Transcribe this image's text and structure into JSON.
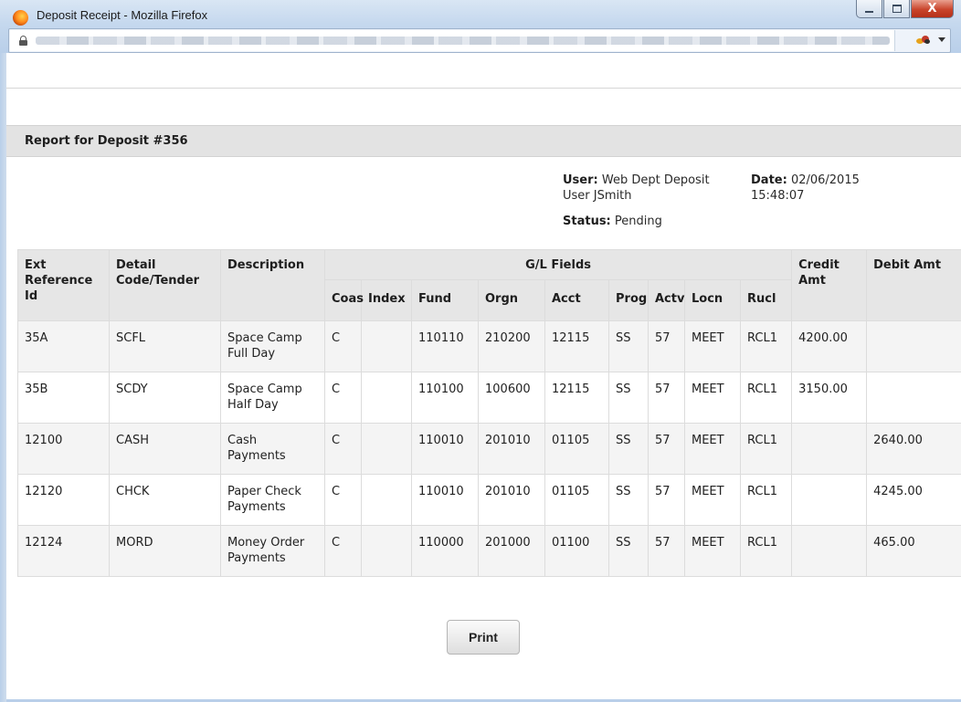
{
  "window": {
    "title": "Deposit Receipt - Mozilla Firefox",
    "minimize_label": "▭",
    "maximize_label": "□",
    "close_label": "X"
  },
  "address_bar": {
    "url": ""
  },
  "report": {
    "heading": "Report for Deposit #356",
    "user_label": "User:",
    "user_value_line1": "Web Dept Deposit",
    "user_value_line2": "User JSmith",
    "date_label": "Date:",
    "date_value_line1": "02/06/2015",
    "date_value_line2": "15:48:07",
    "status_label": "Status:",
    "status_value": "Pending"
  },
  "table": {
    "headers": {
      "ext_reference_id": "Ext Reference Id",
      "detail_code": "Detail Code/Tender",
      "description": "Description",
      "gl_fields": "G/L Fields",
      "credit_amt": "Credit Amt",
      "debit_amt": "Debit Amt",
      "coas": "Coas",
      "index": "Index",
      "fund": "Fund",
      "orgn": "Orgn",
      "acct": "Acct",
      "prog": "Prog",
      "actv": "Actv",
      "locn": "Locn",
      "rucl": "Rucl"
    },
    "rows": [
      {
        "ext": "35A",
        "code": "SCFL",
        "desc": "Space Camp Full Day",
        "coas": "C",
        "index": "",
        "fund": "110110",
        "orgn": "210200",
        "acct": "12115",
        "prog": "SS",
        "actv": "57",
        "locn": "MEET",
        "rucl": "RCL1",
        "credit": "4200.00",
        "debit": ""
      },
      {
        "ext": "35B",
        "code": "SCDY",
        "desc": "Space Camp Half Day",
        "coas": "C",
        "index": "",
        "fund": "110100",
        "orgn": "100600",
        "acct": "12115",
        "prog": "SS",
        "actv": "57",
        "locn": "MEET",
        "rucl": "RCL1",
        "credit": "3150.00",
        "debit": ""
      },
      {
        "ext": "12100",
        "code": "CASH",
        "desc": "Cash Payments",
        "coas": "C",
        "index": "",
        "fund": "110010",
        "orgn": "201010",
        "acct": "01105",
        "prog": "SS",
        "actv": "57",
        "locn": "MEET",
        "rucl": "RCL1",
        "credit": "",
        "debit": "2640.00"
      },
      {
        "ext": "12120",
        "code": "CHCK",
        "desc": "Paper Check Payments",
        "coas": "C",
        "index": "",
        "fund": "110010",
        "orgn": "201010",
        "acct": "01105",
        "prog": "SS",
        "actv": "57",
        "locn": "MEET",
        "rucl": "RCL1",
        "credit": "",
        "debit": "4245.00"
      },
      {
        "ext": "12124",
        "code": "MORD",
        "desc": "Money Order Payments",
        "coas": "C",
        "index": "",
        "fund": "110000",
        "orgn": "201000",
        "acct": "01100",
        "prog": "SS",
        "actv": "57",
        "locn": "MEET",
        "rucl": "RCL1",
        "credit": "",
        "debit": "465.00"
      }
    ]
  },
  "actions": {
    "print_label": "Print"
  }
}
